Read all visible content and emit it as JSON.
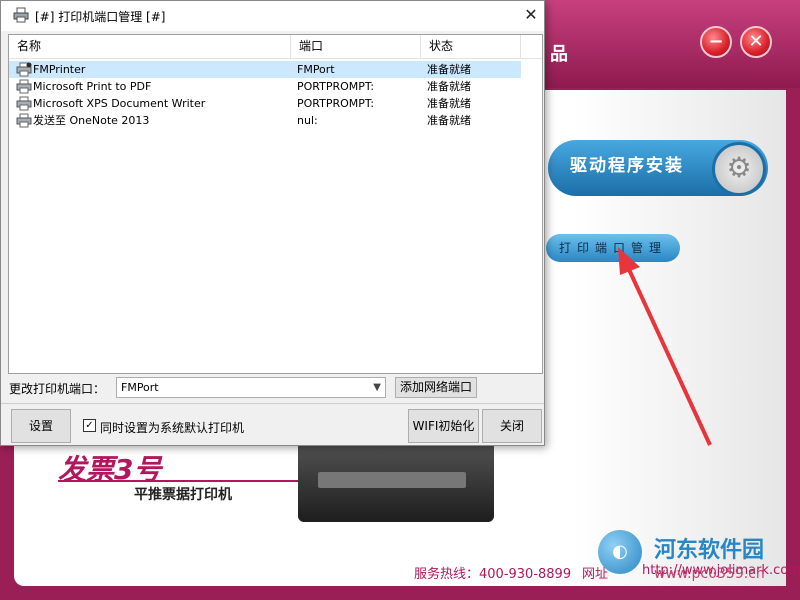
{
  "dialog": {
    "title": "[#] 打印机端口管理 [#]",
    "close_glyph": "✕",
    "columns": [
      "名称",
      "端口",
      "状态"
    ],
    "printers": [
      {
        "name": "FMPrinter",
        "port": "FMPort",
        "status": "准备就绪",
        "selected": true
      },
      {
        "name": "Microsoft Print to PDF",
        "port": "PORTPROMPT:",
        "status": "准备就绪",
        "selected": false
      },
      {
        "name": "Microsoft XPS Document Writer",
        "port": "PORTPROMPT:",
        "status": "准备就绪",
        "selected": false
      },
      {
        "name": "发送至 OneNote 2013",
        "port": "nul:",
        "status": "准备就绪",
        "selected": false
      }
    ],
    "change_port_label": "更改打印机端口：",
    "port_select_value": "FMPort",
    "add_network_port": "添加网络端口",
    "settings_button": "设置",
    "default_checkbox_checked": true,
    "default_checkbox_mark": "✓",
    "default_checkbox_label": "同时设置为系统默认打印机",
    "wifi_button": "WIFI初始化",
    "close_button": "关闭"
  },
  "background_app": {
    "title_fragment": "品",
    "minimize_glyph": "−",
    "close_glyph": "✕",
    "driver_install": "驱动程序安装",
    "print_port_manage": "打印端口管理",
    "product_name": "发票3号",
    "product_subtitle": "平推票据打印机",
    "hotline": "服务热线：400-930-8899",
    "web_label": "网址",
    "web_url": "http://www.jolimark.com"
  },
  "watermark": {
    "title": "河东软件园",
    "url": "www.pc0359.cn"
  },
  "colors": {
    "brand": "#b3165c",
    "selection": "#cce8ff",
    "accent_blue": "#2a86c2"
  }
}
